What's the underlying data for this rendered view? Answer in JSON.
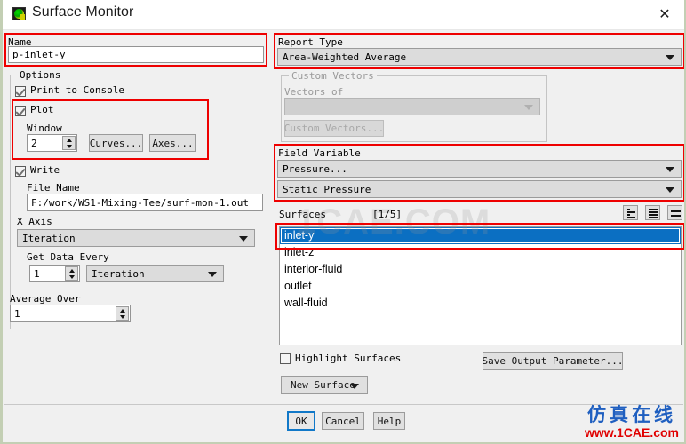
{
  "window": {
    "title": "Surface Monitor",
    "icon": "fluent-monitor-icon",
    "close_label": "✕"
  },
  "name_group": {
    "label": "Name",
    "value": "p-inlet-y",
    "placeholder": ""
  },
  "options_group": {
    "title": "Options",
    "print_to_console": {
      "label": "Print to Console",
      "checked": true
    },
    "plot": {
      "label": "Plot",
      "checked": true
    },
    "window": {
      "label": "Window",
      "value": "2"
    },
    "curves_button": "Curves...",
    "axes_button": "Axes...",
    "write": {
      "label": "Write",
      "checked": true
    },
    "file_name": {
      "label": "File Name",
      "value": "F:/work/WS1-Mixing-Tee/surf-mon-1.out"
    },
    "x_axis": {
      "label": "X Axis",
      "value": "Iteration"
    },
    "get_data_every": {
      "label": "Get Data Every",
      "value": "1",
      "unit": "Iteration"
    },
    "average_over": {
      "label": "Average Over",
      "value": "1"
    }
  },
  "report_type": {
    "label": "Report Type",
    "value": "Area-Weighted Average"
  },
  "custom_vectors": {
    "title": "Custom Vectors",
    "vectors_of_label": "Vectors of",
    "vectors_of_value": "",
    "button": "Custom Vectors..."
  },
  "field_variable": {
    "label": "Field Variable",
    "category": "Pressure...",
    "variable": "Static Pressure"
  },
  "surfaces": {
    "label": "Surfaces",
    "counter": "[1/5]",
    "tool_buttons": [
      "filter-icon",
      "list-icon",
      "equals-icon"
    ],
    "items": [
      {
        "label": "inlet-y",
        "selected": true
      },
      {
        "label": "inlet-z",
        "selected": false
      },
      {
        "label": "interior-fluid",
        "selected": false
      },
      {
        "label": "outlet",
        "selected": false
      },
      {
        "label": "wall-fluid",
        "selected": false
      }
    ],
    "highlight_surfaces": {
      "label": "Highlight Surfaces",
      "checked": false
    },
    "new_surface_button": "New Surface",
    "save_output_parameter_button": "Save Output Parameter..."
  },
  "footer": {
    "ok": "OK",
    "cancel": "Cancel",
    "help": "Help"
  },
  "watermark": {
    "background": "1CAE.COM",
    "brand_cn": "仿真在线",
    "brand_url": "www.1CAE.com"
  },
  "colors": {
    "accent": "#0b6fc2",
    "annotation": "#ee0000",
    "brand_blue": "#1f5fc0",
    "brand_red": "#e00000"
  }
}
